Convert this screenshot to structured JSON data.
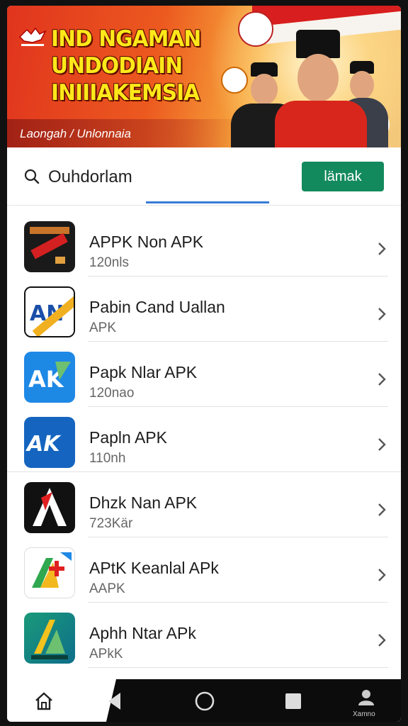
{
  "banner": {
    "title_lines": [
      "IND NGAMAN",
      "UNDODIAIN",
      "INIIIAKEMSIA"
    ],
    "subtitle": "Laongah / Unlonnaia"
  },
  "search": {
    "query": "Ouhdorlam",
    "button_label": "lämak"
  },
  "apps": [
    {
      "name": "APPK Non APK",
      "sub": "120nls",
      "icon": "hammer-app-icon"
    },
    {
      "name": "Pabin Cand Uallan",
      "sub": "APK",
      "icon": "an-app-icon"
    },
    {
      "name": "Papk Nlar APK",
      "sub": "120nao",
      "icon": "ak-blue-app-icon"
    },
    {
      "name": "Papln APK",
      "sub": "110nh",
      "icon": "ak-dark-blue-app-icon"
    },
    {
      "name": "Dhzk Nan APK",
      "sub": "723Kär",
      "icon": "a-black-app-icon"
    },
    {
      "name": "APtK Keanlal APk",
      "sub": "AAPK",
      "icon": "a-plus-app-icon"
    },
    {
      "name": "Aphh Ntar APk",
      "sub": "APkK",
      "icon": "a-green-app-icon"
    }
  ],
  "nav": {
    "profile_label": "Xamno"
  },
  "colors": {
    "accent_green": "#138a5e",
    "tab_blue": "#3a7bd5",
    "banner_red": "#e0341e",
    "banner_yellow": "#ffe81a"
  }
}
